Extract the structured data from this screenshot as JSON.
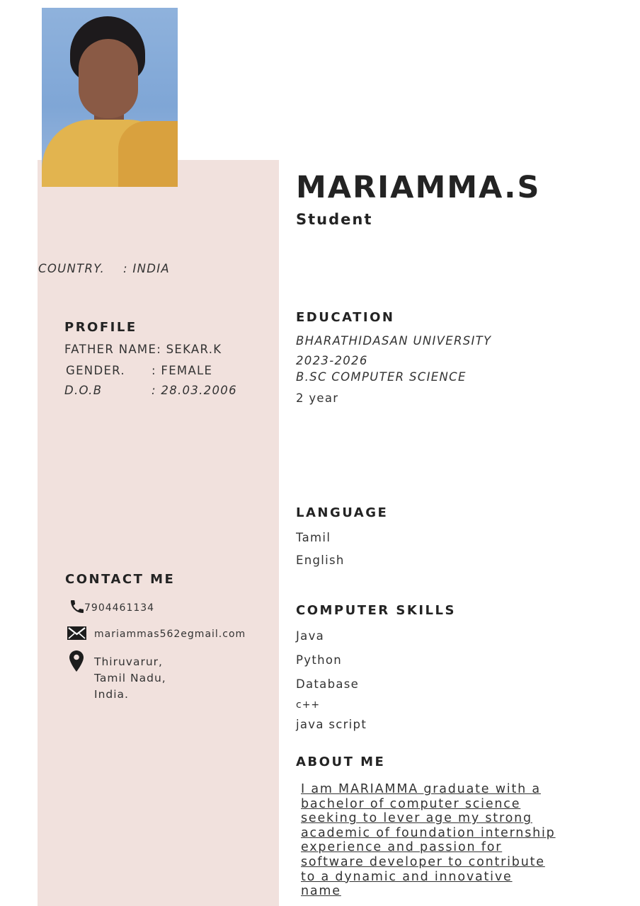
{
  "header": {
    "name": "MARIAMMA.S",
    "role": "Student"
  },
  "personal": {
    "country_label": "COUNTRY.",
    "country_value": ": INDIA"
  },
  "profile": {
    "heading": "PROFILE",
    "father_label": "FATHER NAME: SEKAR.K",
    "gender_label": "GENDER.",
    "gender_value": ": FEMALE",
    "dob_label": "D.O.B",
    "dob_value": ": 28.03.2006"
  },
  "contact": {
    "heading": "CONTACT ME",
    "phone": "7904461134",
    "email": "mariammas562egmail.com",
    "address_line1": "Thiruvarur,",
    "address_line2": "Tamil Nadu,",
    "address_line3": "India."
  },
  "education": {
    "heading": "EDUCATION",
    "university": "BHARATHIDASAN UNIVERSITY",
    "years": "2023-2026",
    "degree": "B.SC COMPUTER SCIENCE",
    "current_year": "2 year"
  },
  "language": {
    "heading": "LANGUAGE",
    "items": [
      "Tamil",
      "English"
    ]
  },
  "skills": {
    "heading": "COMPUTER SKILLS",
    "items": [
      "Java",
      "Python",
      "Database",
      "c++",
      "java script"
    ]
  },
  "about": {
    "heading": "ABOUT ME",
    "text": "I am MARIAMMA graduate with a bachelor of computer science seeking to lever age my strong academic of foundation internship experience and passion for software developer to contribute to a dynamic and innovative name"
  },
  "icons": {
    "phone": "phone-icon",
    "email": "envelope-icon",
    "location": "map-pin-icon"
  },
  "colors": {
    "sidebar": "#f1e1dd",
    "text": "#232323"
  }
}
